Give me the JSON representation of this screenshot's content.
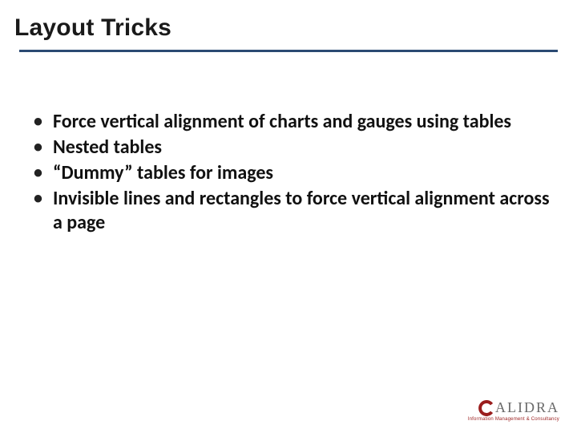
{
  "title": "Layout Tricks",
  "bullets": [
    "Force vertical alignment of charts and gauges using tables",
    "Nested tables",
    "“Dummy” tables for images",
    "Invisible lines and rectangles to force vertical alignment across a page"
  ],
  "logo": {
    "text": "ALIDRA",
    "tagline": "Information Management & Consultancy"
  }
}
